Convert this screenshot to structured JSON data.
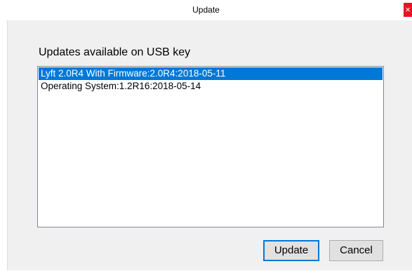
{
  "window": {
    "title": "Update",
    "close_glyph": "×"
  },
  "heading": "Updates available on USB key",
  "updates_list": {
    "items": [
      {
        "label": "Lyft 2.0R4 With Firmware:2.0R4:2018-05-11",
        "selected": true
      },
      {
        "label": "Operating System:1.2R16:2018-05-14",
        "selected": false
      }
    ]
  },
  "buttons": {
    "update_label": "Update",
    "cancel_label": "Cancel"
  },
  "colors": {
    "selection": "#0078d7",
    "close_button": "#e81123",
    "dialog_background": "#f0f0f0"
  }
}
